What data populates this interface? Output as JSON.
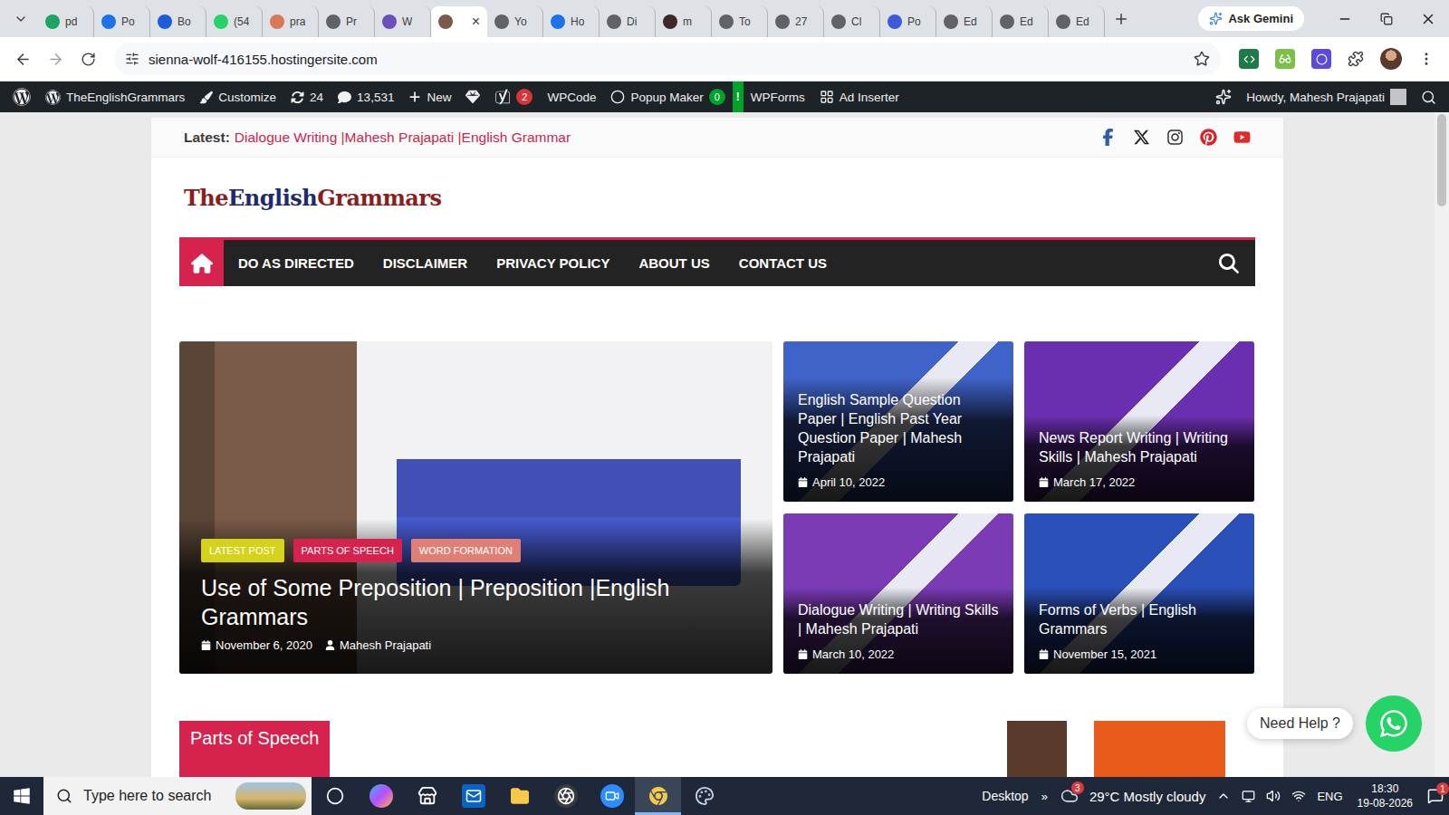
{
  "browser": {
    "tabs": [
      {
        "label": "pd",
        "color": "#1fa463",
        "selected": false
      },
      {
        "label": "Po",
        "color": "#1a73e8",
        "selected": false
      },
      {
        "label": "Bo",
        "color": "#1e5bd8",
        "selected": false
      },
      {
        "label": "(54",
        "color": "#25d366",
        "selected": false
      },
      {
        "label": "pra",
        "color": "#d97757",
        "selected": false
      },
      {
        "label": "Pr",
        "color": "#5f6368",
        "selected": false
      },
      {
        "label": "W",
        "color": "#6b4fbb",
        "selected": false
      },
      {
        "close": "×",
        "color": "#7a5a48",
        "selected": true
      },
      {
        "label": "Yo",
        "color": "#5f6368",
        "selected": false
      },
      {
        "label": "Ho",
        "color": "#1a73e8",
        "selected": false
      },
      {
        "label": "Di",
        "color": "#5f6368",
        "selected": false
      },
      {
        "label": "m",
        "color": "#3c2a2a",
        "selected": false
      },
      {
        "label": "To",
        "color": "#5f6368",
        "selected": false
      },
      {
        "label": "27",
        "color": "#5f6368",
        "selected": false
      },
      {
        "label": "Cl",
        "color": "#5f6368",
        "selected": false
      },
      {
        "label": "Po",
        "color": "#3b5bdb",
        "selected": false
      },
      {
        "label": "Ed",
        "color": "#5f6368",
        "selected": false
      },
      {
        "label": "Ed",
        "color": "#5f6368",
        "selected": false
      },
      {
        "label": "Ed",
        "color": "#5f6368",
        "selected": false
      }
    ],
    "gemini": "Ask Gemini",
    "address": "sienna-wolf-416155.hostingersite.com",
    "bookmarked": false
  },
  "admin_bar": {
    "items": [
      {
        "kind": "wp"
      },
      {
        "kind": "site",
        "label": "TheEnglishGrammars"
      },
      {
        "kind": "customize",
        "label": "Customize"
      },
      {
        "kind": "updates",
        "label": "24"
      },
      {
        "kind": "comments",
        "label": "13,531"
      },
      {
        "kind": "new",
        "label": "New"
      },
      {
        "kind": "diamond"
      },
      {
        "kind": "yoast",
        "badge": "2",
        "badge_color": "#d63638"
      },
      {
        "kind": "code",
        "label": "WPCode"
      },
      {
        "kind": "popup",
        "label": "Popup Maker",
        "badge": "0",
        "badge_color": "#00a32a"
      },
      {
        "kind": "alert",
        "label": "!"
      },
      {
        "kind": "text",
        "label": "WPForms"
      },
      {
        "kind": "adinserter",
        "label": "Ad Inserter"
      }
    ],
    "greeting": "Howdy, Mahesh Prajapati"
  },
  "page": {
    "scrollbar": {
      "level": 0.14
    },
    "latest": {
      "label": "Latest:",
      "link": "Dialogue Writing |Mahesh Prajapati |English Grammar"
    },
    "socials": [
      {
        "kind": "facebook",
        "color": "#2d5fa5"
      },
      {
        "kind": "x",
        "color": "#222222"
      },
      {
        "kind": "instagram",
        "color": "#333333"
      },
      {
        "kind": "pinterest",
        "color": "#d8232a"
      },
      {
        "kind": "youtube",
        "color": "#e02b2b"
      }
    ],
    "logo": [
      {
        "text": "The",
        "color": "#8b1d1d"
      },
      {
        "text": "English",
        "color": "#1f2a6e"
      },
      {
        "text": "Grammars",
        "color": "#8b1d1d"
      }
    ],
    "nav": [
      {
        "label": "DO AS DIRECTED",
        "selected": false
      },
      {
        "label": "DISCLAIMER",
        "selected": false
      },
      {
        "label": "PRIVACY POLICY",
        "selected": false
      },
      {
        "label": "ABOUT US",
        "selected": false
      },
      {
        "label": "CONTACT US",
        "selected": false
      }
    ],
    "home_selected": true,
    "featured": {
      "tags": [
        {
          "label": "LATEST POST",
          "color": "#d4d21a"
        },
        {
          "label": "PARTS OF SPEECH",
          "color": "#d6234e"
        },
        {
          "label": "WORD FORMATION",
          "color": "#e07f75"
        }
      ],
      "title": "Use of Some Preposition | Preposition |English Grammars",
      "date": "November 6, 2020",
      "author": "Mahesh Prajapati"
    },
    "cards": [
      {
        "title": "English Sample Question Paper | English Past Year Question Paper | Mahesh Prajapati",
        "date": "April 10, 2022",
        "color": "#3f63c9"
      },
      {
        "title": "News Report Writing | Writing Skills | Mahesh Prajapati",
        "date": "March 17, 2022",
        "color": "#6a2fb0"
      },
      {
        "title": "Dialogue Writing | Writing Skills | Mahesh Prajapati",
        "date": "March 10, 2022",
        "color": "#7b3bb5"
      },
      {
        "title": "Forms of Verbs | English Grammars",
        "date": "November 15, 2021",
        "color": "#2b4fb8"
      }
    ],
    "section": "Parts of Speech"
  },
  "whatsapp": {
    "label": "Need Help ?"
  },
  "taskbar": {
    "search": "Type here to search",
    "apps": [
      {
        "kind": "cortana",
        "active": false
      },
      {
        "kind": "copilot",
        "active": false
      },
      {
        "kind": "store",
        "active": false
      },
      {
        "kind": "outlook",
        "active": false
      },
      {
        "kind": "explorer",
        "active": false
      },
      {
        "kind": "obs",
        "active": false
      },
      {
        "kind": "zoom",
        "active": false
      },
      {
        "kind": "chrome",
        "active": true
      },
      {
        "kind": "paint",
        "active": false
      }
    ],
    "desktop": "Desktop",
    "more": "»",
    "weather_badge": "3",
    "weather": "29°C Mostly cloudy",
    "language": "ENG",
    "time": "18:30",
    "date": "19-08-2026",
    "notifications": "1"
  }
}
